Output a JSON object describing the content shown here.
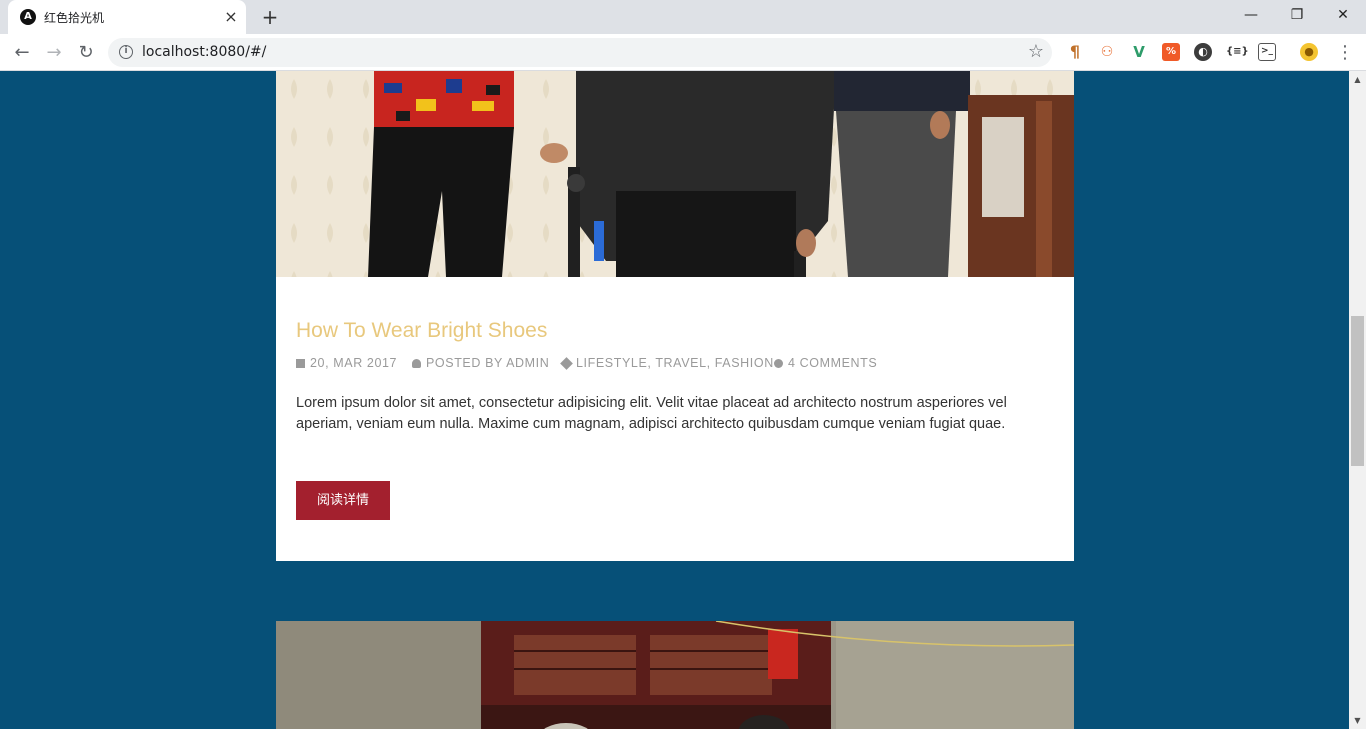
{
  "browser": {
    "tab_title": "红色拾光机",
    "favicon_letter": "A",
    "new_tab_symbol": "+",
    "url": "localhost:8080/#/",
    "window_controls": {
      "minimize": "—",
      "restore": "❐",
      "close": "✕"
    }
  },
  "post": {
    "title": "How To Wear Bright Shoes",
    "meta": {
      "date": "20, MAR 2017",
      "author": "POSTED BY ADMIN",
      "tags": "LIFESTYLE, TRAVEL, FASHION",
      "comments": "4 COMMENTS"
    },
    "excerpt": "Lorem ipsum dolor sit amet, consectetur adipisicing elit. Velit vitae placeat ad architecto nostrum asperiores vel aperiam, veniam eum nulla. Maxime cum magnam, adipisci architecto quibusdam cumque veniam fugiat quae.",
    "read_more_label": "阅读详情"
  },
  "colors": {
    "page_background": "#065078",
    "title_color": "#e8c87d",
    "button_color": "#a3202e"
  }
}
